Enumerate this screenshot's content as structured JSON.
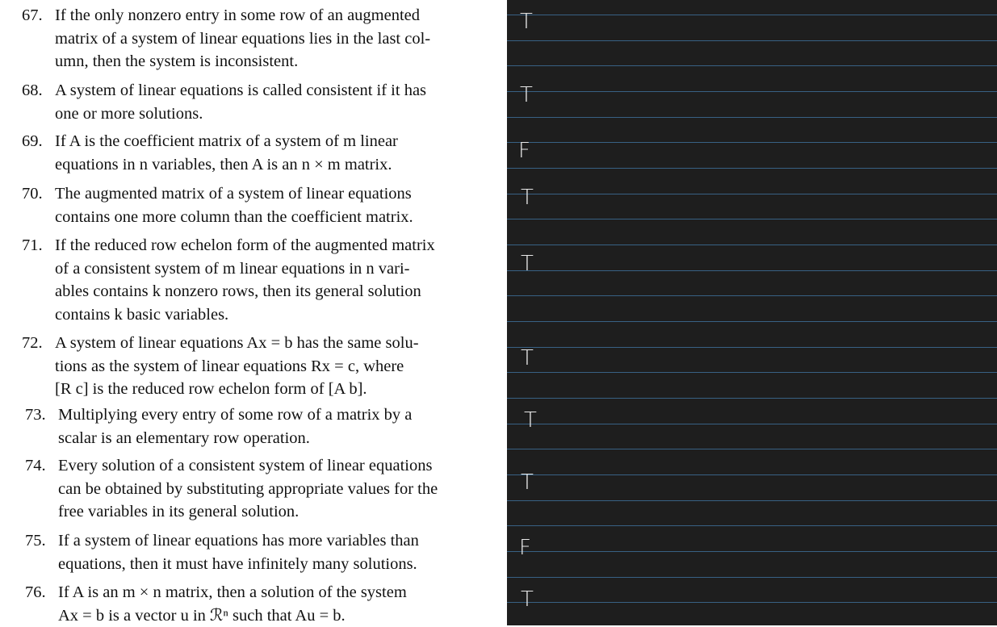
{
  "questions": [
    {
      "number": "67.",
      "lines": [
        "If the only nonzero entry in some row of an augmented",
        "matrix of a system of linear equations lies in the last col-",
        "umn, then the system is inconsistent."
      ]
    },
    {
      "number": "68.",
      "lines": [
        "A system of linear equations is called consistent if it has",
        "one or more solutions."
      ]
    },
    {
      "number": "69.",
      "lines": [
        "If A is the coefficient matrix of a system of m linear",
        "equations in n variables, then A is an n × m matrix."
      ]
    },
    {
      "number": "70.",
      "lines": [
        "The augmented matrix of a system of linear equations",
        "contains one more column than the coefficient matrix."
      ]
    },
    {
      "number": "71.",
      "lines": [
        "If the reduced row echelon form of the augmented matrix",
        "of a consistent system of m linear equations in n vari-",
        "ables contains k nonzero rows, then its general solution",
        "contains k basic variables."
      ]
    },
    {
      "number": "72.",
      "lines": [
        "A system of linear equations Ax = b has the same solu-",
        "tions as the system of linear equations Rx = c, where",
        "[R c] is the reduced row echelon form of [A b]."
      ]
    },
    {
      "number": "73.",
      "lines": [
        "Multiplying every entry of some row of a matrix by a",
        "scalar is an elementary row operation."
      ]
    },
    {
      "number": "74.",
      "lines": [
        "Every solution of a consistent system of linear equations",
        "can be obtained by substituting appropriate values for the",
        "free variables in its general solution."
      ]
    },
    {
      "number": "75.",
      "lines": [
        "If a system of linear equations has more variables than",
        "equations, then it must have infinitely many solutions."
      ]
    },
    {
      "number": "76.",
      "lines": [
        "If A is an m × n matrix, then a solution of the system",
        "Ax = b is a vector u in ℛⁿ such that Au = b."
      ]
    }
  ],
  "answers": [
    "T",
    "T",
    "F",
    "T",
    "T",
    "T",
    "T",
    "T",
    "F",
    "T"
  ]
}
